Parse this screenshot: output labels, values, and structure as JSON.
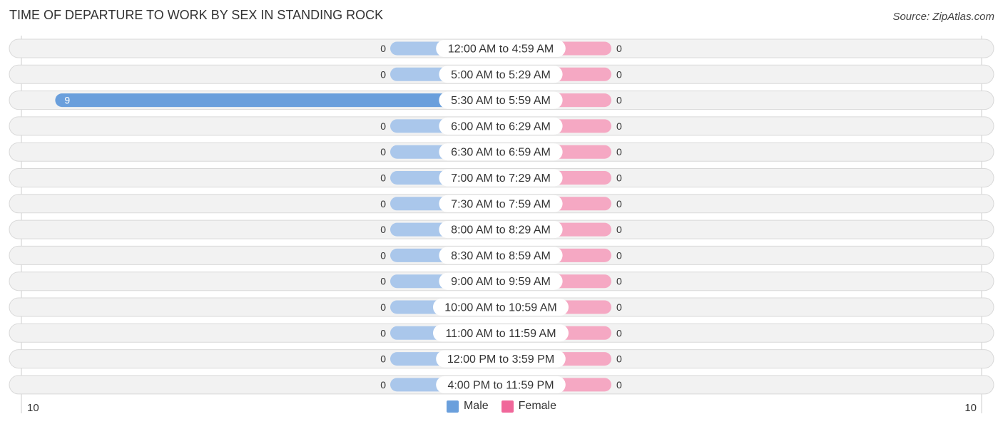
{
  "header": {
    "title": "TIME OF DEPARTURE TO WORK BY SEX IN STANDING ROCK",
    "source": "Source: ZipAtlas.com"
  },
  "colors": {
    "male_bar": "#6a9fdc",
    "male_stub": "#aac7eb",
    "female_bar": "#f0679a",
    "female_stub": "#f5a8c3",
    "row_bg": "#f2f2f2",
    "row_border": "#d9d9d9",
    "legend_male": "#6a9fdc",
    "legend_female": "#f0679a"
  },
  "legend": {
    "male": "Male",
    "female": "Female"
  },
  "chart_data": {
    "type": "bar",
    "orientation": "horizontal-diverging",
    "title": "TIME OF DEPARTURE TO WORK BY SEX IN STANDING ROCK",
    "xlabel": "",
    "ylabel": "",
    "xlim": [
      -10,
      10
    ],
    "axis_tick_labels": {
      "left": "10",
      "right": "10"
    },
    "legend_position": "bottom-center",
    "categories": [
      "12:00 AM to 4:59 AM",
      "5:00 AM to 5:29 AM",
      "5:30 AM to 5:59 AM",
      "6:00 AM to 6:29 AM",
      "6:30 AM to 6:59 AM",
      "7:00 AM to 7:29 AM",
      "7:30 AM to 7:59 AM",
      "8:00 AM to 8:29 AM",
      "8:30 AM to 8:59 AM",
      "9:00 AM to 9:59 AM",
      "10:00 AM to 10:59 AM",
      "11:00 AM to 11:59 AM",
      "12:00 PM to 3:59 PM",
      "4:00 PM to 11:59 PM"
    ],
    "series": [
      {
        "name": "Male",
        "values": [
          0,
          0,
          9,
          0,
          0,
          0,
          0,
          0,
          0,
          0,
          0,
          0,
          0,
          0
        ]
      },
      {
        "name": "Female",
        "values": [
          0,
          0,
          0,
          0,
          0,
          0,
          0,
          0,
          0,
          0,
          0,
          0,
          0,
          0
        ]
      }
    ]
  }
}
